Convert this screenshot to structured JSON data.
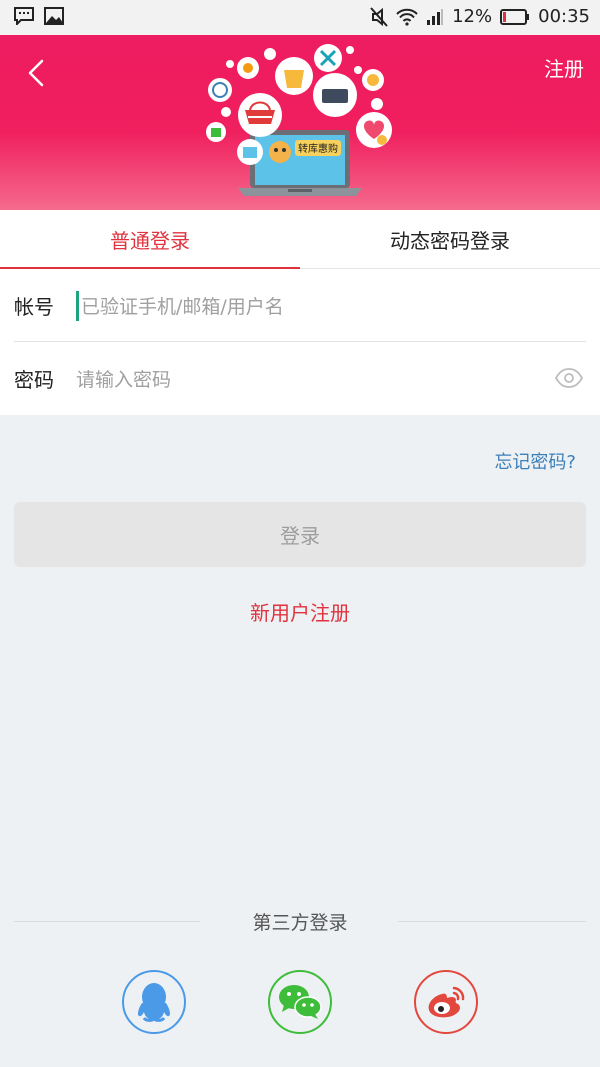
{
  "status_bar": {
    "battery": "12%",
    "time": "00:35"
  },
  "header": {
    "register_label": "注册",
    "illustration_text": "转库惠购"
  },
  "tabs": [
    {
      "label": "普通登录",
      "active": true
    },
    {
      "label": "动态密码登录",
      "active": false
    }
  ],
  "form": {
    "account_label": "帐号",
    "account_placeholder": "已验证手机/邮箱/用户名",
    "password_label": "密码",
    "password_placeholder": "请输入密码"
  },
  "forgot_label": "忘记密码?",
  "login_button_label": "登录",
  "new_user_label": "新用户注册",
  "third_party": {
    "title": "第三方登录",
    "providers": [
      "qq-icon",
      "wechat-icon",
      "weibo-icon"
    ]
  },
  "colors": {
    "brand": "#ee1c60",
    "accent_red": "#e0333f",
    "link_blue": "#3d7fb8",
    "qq": "#4a9ae8",
    "wechat": "#3dbd3a",
    "weibo": "#e2483d"
  }
}
